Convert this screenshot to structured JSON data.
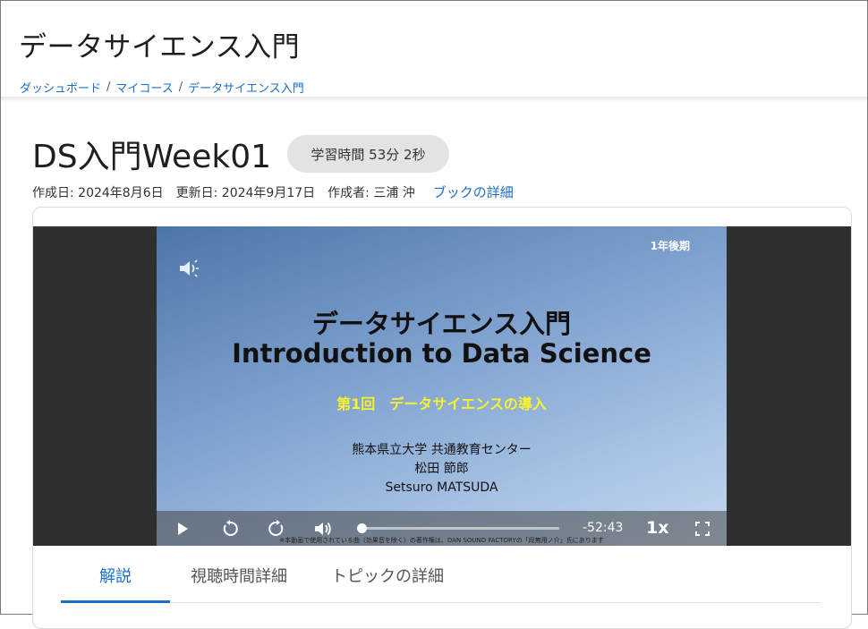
{
  "course": {
    "title": "データサイエンス入門"
  },
  "breadcrumb": [
    {
      "label": "ダッシュボード"
    },
    {
      "label": "マイコース"
    },
    {
      "label": "データサイエンス入門"
    }
  ],
  "book": {
    "title": "DS入門Week01",
    "study_time": "学習時間 53分 2秒",
    "created": "作成日: 2024年8月6日",
    "updated": "更新日: 2024年9月17日",
    "author": "作成者: 三浦 沖",
    "details_link": "ブックの詳細"
  },
  "video": {
    "slide": {
      "term": "1年後期",
      "title_jp": "データサイエンス入門",
      "title_en": "Introduction to Data Science",
      "lecture": "第1回　データサイエンスの導入",
      "institution": "熊本県立大学 共通教育センター",
      "instructor_jp": "松田 節郎",
      "instructor_en": "Setsuro MATSUDA"
    },
    "remaining_time": "-52:43",
    "speed": "1x",
    "progress": 0.0,
    "copyright": "※本動画で使用されている曲（効果音を除く）の著作権は、DAN SOUND FACTORYの「段無用ノ介」氏にあります"
  },
  "tabs": [
    {
      "label": "解説",
      "active": true
    },
    {
      "label": "視聴時間詳細",
      "active": false
    },
    {
      "label": "トピックの詳細",
      "active": false
    }
  ],
  "colors": {
    "link": "#1a6fc9",
    "badge_bg": "#e3e3e3",
    "slide_accent": "#f6f22e"
  }
}
